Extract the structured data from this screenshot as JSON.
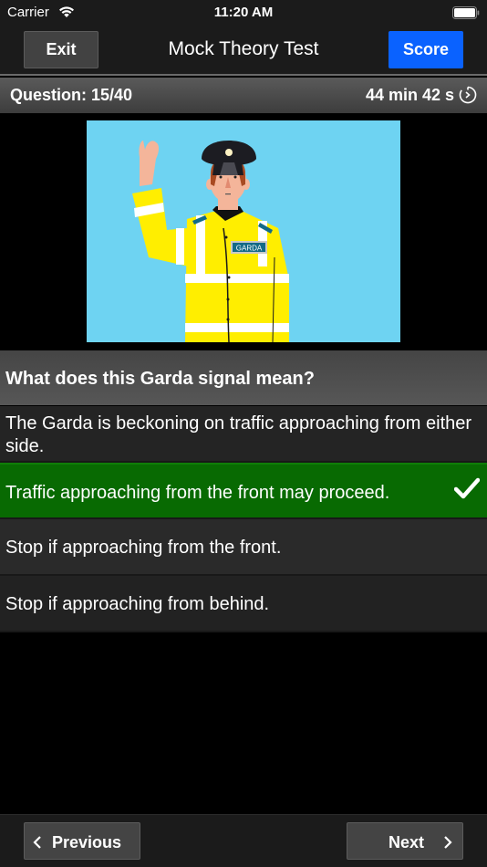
{
  "status_bar": {
    "carrier": "Carrier",
    "time": "11:20 AM",
    "wifi_icon": "wifi-icon",
    "battery_icon": "battery-full-icon"
  },
  "nav": {
    "exit_label": "Exit",
    "title": "Mock Theory Test",
    "score_label": "Score",
    "score_color": "#0a62ff"
  },
  "info": {
    "question_counter": "Question: 15/40",
    "timer": "44 min 42 s",
    "timer_icon": "timer-icon"
  },
  "image": {
    "badge_text": "GARDA",
    "description": "Garda officer in high-visibility jacket raising right hand, palm facing forward"
  },
  "question": {
    "text": "What does this Garda signal mean?"
  },
  "answers": [
    {
      "text": "The Garda is beckoning on traffic approaching from either side.",
      "selected": false
    },
    {
      "text": "Traffic approaching from the front may proceed.",
      "selected": true,
      "correct": true,
      "icon": "checkmark-icon"
    },
    {
      "text": "Stop if approaching from the front.",
      "selected": false
    },
    {
      "text": "Stop if approaching from behind.",
      "selected": false
    }
  ],
  "colors": {
    "correct": "#086a02",
    "accent": "#0a62ff"
  },
  "footer": {
    "previous_label": "Previous",
    "next_label": "Next"
  }
}
